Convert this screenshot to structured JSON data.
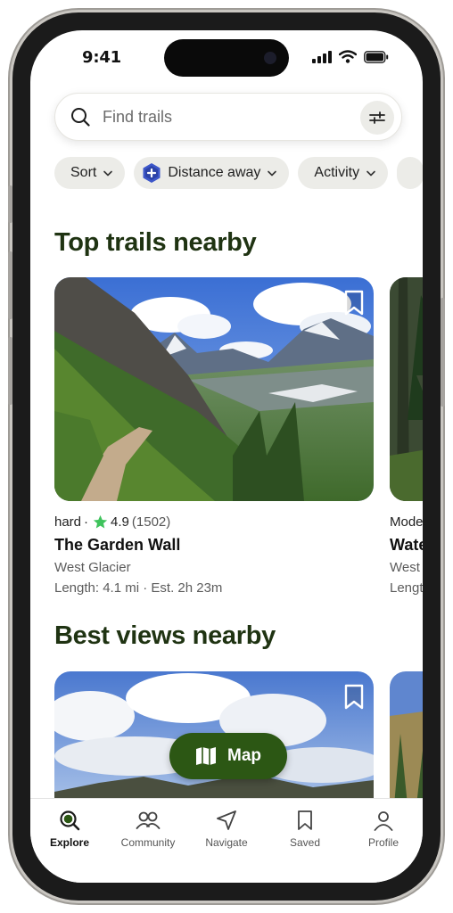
{
  "status_bar": {
    "time": "9:41"
  },
  "search": {
    "placeholder": "Find trails"
  },
  "filters": [
    {
      "label": "Sort"
    },
    {
      "label": "Distance away"
    },
    {
      "label": "Activity"
    }
  ],
  "sections": {
    "top_trails": "Top trails nearby",
    "best_views": "Best views nearby"
  },
  "cards": [
    {
      "difficulty": "hard",
      "dot": "·",
      "rating": "4.9",
      "reviews": "(1502)",
      "name": "The Garden Wall",
      "location": "West Glacier",
      "length": "Length: 4.1 mi · Est. 2h 23m"
    },
    {
      "difficulty": "Mode",
      "name": "Wate",
      "location": "West",
      "length": "Lengt"
    }
  ],
  "map_button": {
    "label": "Map"
  },
  "tabs": [
    {
      "label": "Explore",
      "icon": "explore-icon",
      "active": true
    },
    {
      "label": "Community",
      "icon": "community-icon"
    },
    {
      "label": "Navigate",
      "icon": "navigate-icon"
    },
    {
      "label": "Saved",
      "icon": "saved-icon"
    },
    {
      "label": "Profile",
      "icon": "profile-icon"
    }
  ],
  "colors": {
    "brand_green": "#2c5714",
    "title_green": "#1f3312",
    "star_green": "#3fc35c"
  }
}
